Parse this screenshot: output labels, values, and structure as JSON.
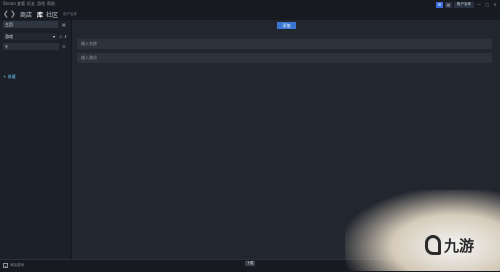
{
  "menu": [
    "Steam",
    "查看",
    "好友",
    "游戏",
    "帮助"
  ],
  "window": {
    "account": "账户名称",
    "minimize": "—",
    "maximize": "□",
    "close": "✕",
    "notify": "✉",
    "chat": "▤"
  },
  "nav": {
    "back": "❮",
    "forward": "❯",
    "store": "商店",
    "library": "库",
    "community": "社区",
    "username": "用户名称"
  },
  "sidebar": {
    "home": "主页",
    "filter": "游戏",
    "search_placeholder": "",
    "category_item": "+ 收藏"
  },
  "main": {
    "button": "添加",
    "field1": "输入名称",
    "field2": "输入路径"
  },
  "bottom": {
    "add_label": "添加游戏",
    "center": "下载"
  },
  "watermark": {
    "text": "九游",
    "mark": ""
  }
}
